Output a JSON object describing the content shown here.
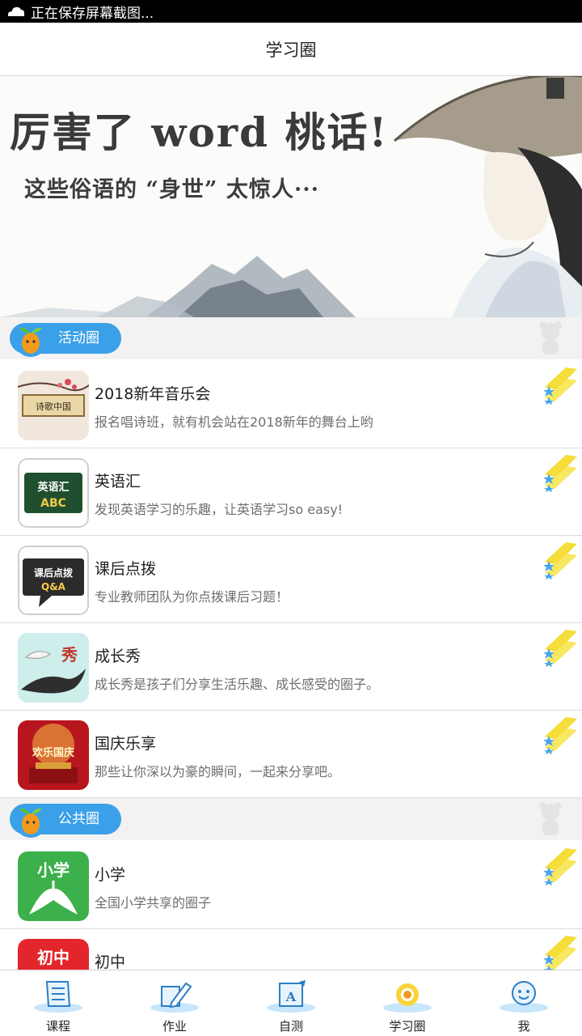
{
  "status_bar": {
    "text": "正在保存屏幕截图..."
  },
  "header": {
    "title": "学习圈"
  },
  "banner": {
    "title": "厉害了 word 桃话!",
    "subtitle": "这些俗语的 “身世” 太惊人···"
  },
  "sections": [
    {
      "label": "活动圈",
      "items": [
        {
          "title": "2018新年音乐会",
          "desc": "报名唱诗班，就有机会站在2018新年的舞台上哟",
          "thumb_text": "诗歌中国"
        },
        {
          "title": "英语汇",
          "desc": "发现英语学习的乐趣，让英语学习so easy!",
          "thumb_text": "英语汇",
          "thumb_sub": "ABC"
        },
        {
          "title": "课后点拨",
          "desc": "专业教师团队为你点拨课后习题！",
          "thumb_text": "课后点拨",
          "thumb_sub": "Q&A"
        },
        {
          "title": "成长秀",
          "desc": "成长秀是孩子们分享生活乐趣、成长感受的圈子。",
          "thumb_text": "秀"
        },
        {
          "title": "国庆乐享",
          "desc": "那些让你深以为豪的瞬间，一起来分享吧。",
          "thumb_text": "欢乐国庆"
        }
      ]
    },
    {
      "label": "公共圈",
      "items": [
        {
          "title": "小学",
          "desc": "全国小学共享的圈子",
          "thumb_text": "小学"
        },
        {
          "title": "初中",
          "desc": "",
          "thumb_text": "初中"
        }
      ]
    }
  ],
  "tabs": [
    {
      "label": "课程",
      "icon": "book-icon"
    },
    {
      "label": "作业",
      "icon": "pencil-icon"
    },
    {
      "label": "自测",
      "icon": "test-icon"
    },
    {
      "label": "学习圈",
      "icon": "circle-icon"
    },
    {
      "label": "我",
      "icon": "face-icon"
    }
  ],
  "colors": {
    "accent": "#3aa0e8",
    "section_bg": "#f2f2f2",
    "star": "#f5dd3a"
  }
}
